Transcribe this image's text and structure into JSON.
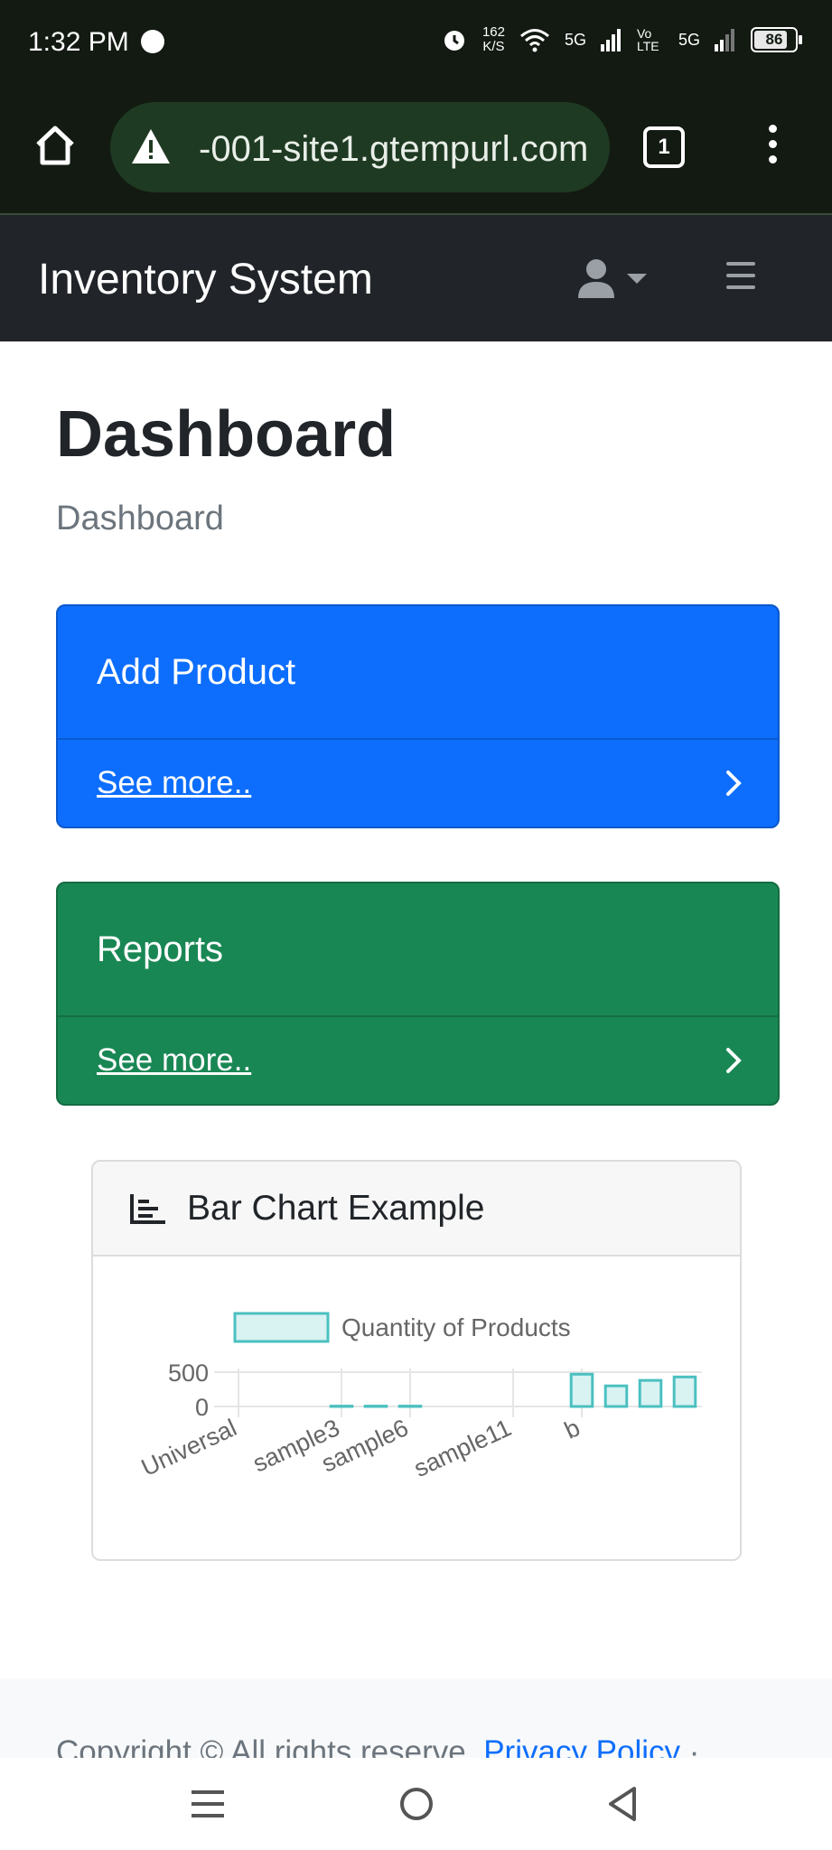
{
  "status_bar": {
    "time": "1:32 PM",
    "net_speed_value": "162",
    "net_speed_unit": "K/S",
    "sim1": "5G",
    "volte": "Vo LTE",
    "sim2": "5G",
    "battery": "86",
    "battery_level": 0.86
  },
  "browser": {
    "url": "-001-site1.gtempurl.com",
    "tab_count": "1"
  },
  "navbar": {
    "brand": "Inventory System"
  },
  "page": {
    "title": "Dashboard",
    "breadcrumb": "Dashboard"
  },
  "cards": [
    {
      "title": "Add Product",
      "link": "See more..",
      "color": "#0d6efd"
    },
    {
      "title": "Reports",
      "link": "See more..",
      "color": "#198754"
    }
  ],
  "chart_card": {
    "title": "Bar Chart Example",
    "icon": "chart-bar-icon"
  },
  "chart_data": {
    "type": "bar",
    "title": "",
    "legend": [
      "Quantity of Products"
    ],
    "legend_placement": "top",
    "categories": [
      "Universal",
      "",
      "",
      "sample3",
      "",
      "sample6",
      "",
      "",
      "sample11",
      "",
      "b",
      "",
      "",
      ""
    ],
    "tick_labels": [
      "Universal",
      "sample3",
      "sample6",
      "sample11",
      "b"
    ],
    "values": [
      0,
      0,
      0,
      5,
      5,
      5,
      0,
      0,
      0,
      0,
      470,
      300,
      380,
      430
    ],
    "yticks": [
      0,
      500
    ],
    "ylim": [
      0,
      500
    ],
    "grid": true,
    "bar_color": "#4bc0c0",
    "bar_fill": "#d9f2f2"
  },
  "footer": {
    "copyright": "Copyright © All rights reserve.",
    "privacy": "Privacy Policy",
    "separator": "·"
  }
}
